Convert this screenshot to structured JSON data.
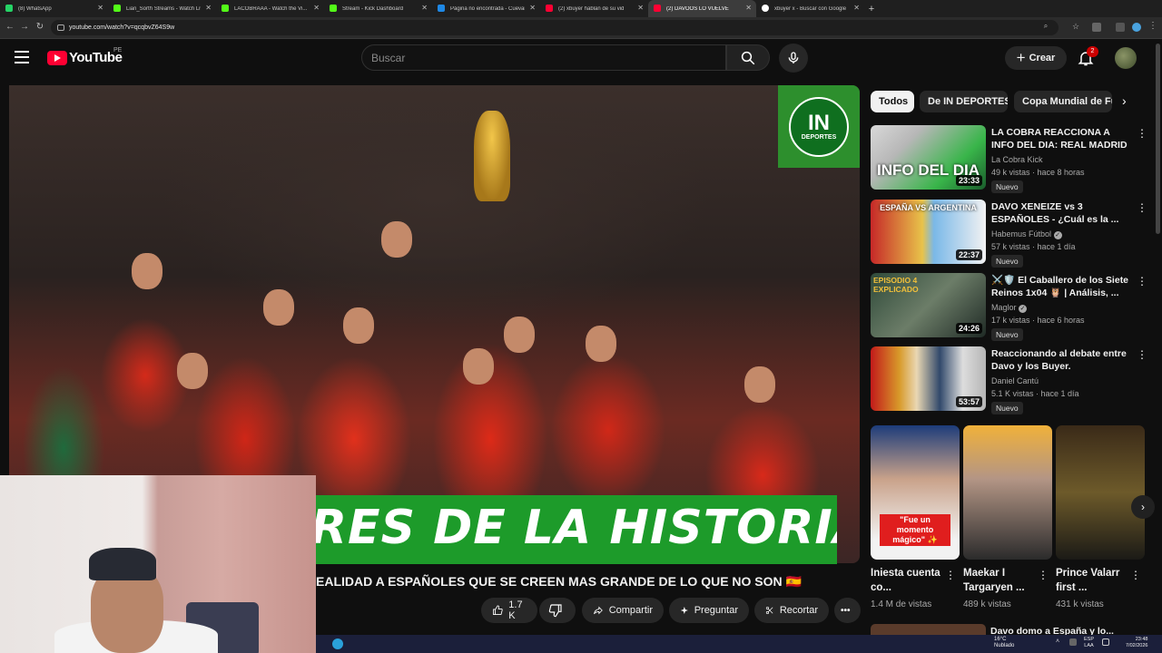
{
  "browser": {
    "tabs": [
      {
        "label": "(8) WhatsApp",
        "favicon": "#25d366"
      },
      {
        "label": "Lian_Sorth Streams - Watch Live",
        "favicon": "#53fc18"
      },
      {
        "label": "LACOBRAAA - Watch the Vi...",
        "favicon": "#53fc18"
      },
      {
        "label": "Stream - Kick Dashboard",
        "favicon": "#53fc18"
      },
      {
        "label": "Página no encontrada - Cuevana",
        "favicon": "#1e88e5"
      },
      {
        "label": "(2) xbuyer hablan de su vid",
        "favicon": "#ff0033"
      },
      {
        "label": "(2) DAVOOS LO VUELVE",
        "favicon": "#ff0033"
      },
      {
        "label": "xbuyer x - Buscar con Google",
        "favicon": "#ffffff"
      }
    ],
    "active_tab_index": 6,
    "new_tab": "+",
    "url": "youtube.com/watch?v=qcqbvZ64S9w"
  },
  "header": {
    "logo_text": "YouTube",
    "country_code": "PE",
    "search_placeholder": "Buscar",
    "create_label": "Crear",
    "notification_count": "2"
  },
  "video": {
    "channel_badge_top": "IN",
    "channel_badge_bottom": "DEPORTES",
    "banner_text": "RES DE LA HISTORIA",
    "title": "EALIDAD A ESPAÑOLES QUE SE CREEN MAS GRANDE DE LO QUE NO SON 🇪🇸",
    "like_count": "1.7 K",
    "share_label": "Compartir",
    "ask_label": "Preguntar",
    "clip_label": "Recortar",
    "more_label": "•••"
  },
  "chips": [
    "Todos",
    "De IN DEPORTES",
    "Copa Mundial de Fútbol"
  ],
  "recommendations": [
    {
      "title": "LA COBRA REACCIONA A INFO DEL DIA: REAL MADRID QUIER...",
      "channel": "La Cobra Kick",
      "meta": "49 k vistas · hace 8 horas",
      "badge": "Nuevo",
      "duration": "23:33",
      "thumb_text": "INFO DEL DIA"
    },
    {
      "title": "DAVO XENEIZE vs 3 ESPAÑOLES - ¿Cuál es la ...",
      "channel": "Habemus Fútbol",
      "meta": "57 k vistas · hace 1 día",
      "badge": "Nuevo",
      "duration": "22:37",
      "thumb_text": "ESPAÑA VS ARGENTINA"
    },
    {
      "title": "⚔️🛡️ El Caballero de los Siete Reinos 1x04 🦉 | Análisis, ...",
      "channel": "Maglor",
      "meta": "17 k vistas · hace 6 horas",
      "badge": "Nuevo",
      "duration": "24:26",
      "thumb_text": "EPISODIO 4 EXPLICADO"
    },
    {
      "title": "Reaccionando al debate entre Davo y los Buyer.",
      "channel": "Daniel Cantú",
      "meta": "5.1 K vistas · hace 1 día",
      "badge": "Nuevo",
      "duration": "53:57",
      "thumb_text": ""
    }
  ],
  "shorts": [
    {
      "title": "Iniesta cuenta co...",
      "views": "1.4 M de vistas",
      "caption": "\"Fue un momento mágico\" ✨"
    },
    {
      "title": "Maekar I Targaryen ...",
      "views": "489 k vistas",
      "caption": ""
    },
    {
      "title": "Prince Valarr first ...",
      "views": "431 k vistas",
      "caption": ""
    }
  ],
  "next_item_title": "Davo domo a España y lo...",
  "taskbar": {
    "weather_temp": "16°C",
    "weather_desc": "Nublado",
    "lang_top": "ESP",
    "lang_bottom": "LAA",
    "time": "23:48",
    "date": "7/02/2026"
  }
}
